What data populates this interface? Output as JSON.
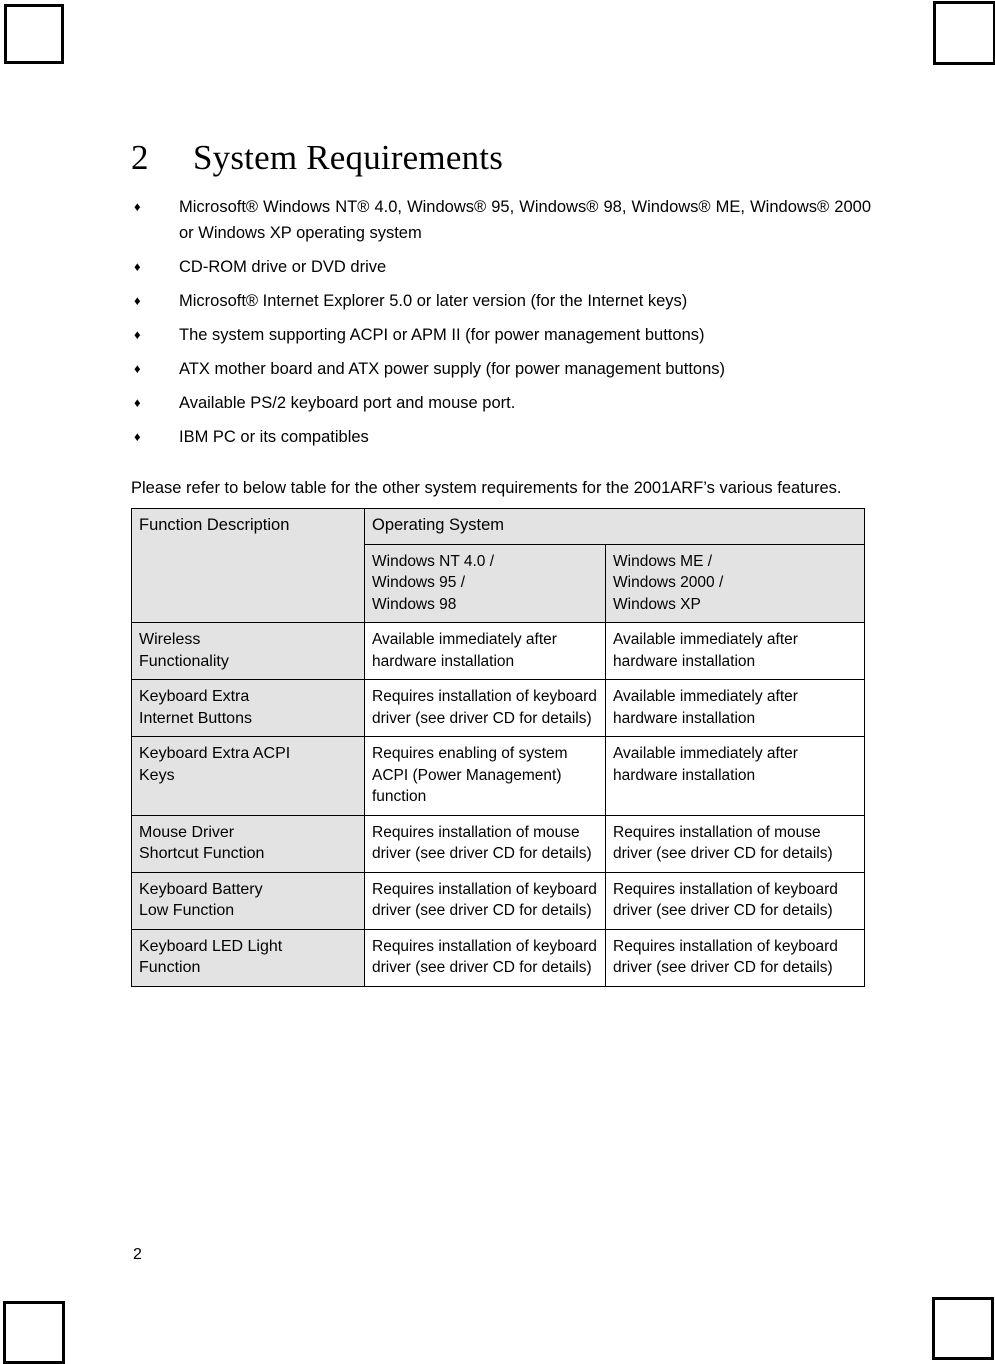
{
  "document": {
    "chapter_number": "2",
    "chapter_title": "System Requirements",
    "page_number": "2",
    "intro_paragraph": "Please refer to below table for the other system requirements for the 2001ARF’s various features.",
    "bullet_glyph": "♦",
    "requirements": [
      "Microsoft® Windows NT® 4.0, Windows® 95, Windows® 98, Windows® ME, Windows® 2000 or Windows XP operating system",
      "CD-ROM drive or DVD drive",
      "Microsoft® Internet Explorer 5.0 or later version (for the Internet keys)",
      "The system supporting ACPI or APM II (for power management buttons)",
      "ATX mother board and ATX power supply (for power management buttons)",
      "Available PS/2 keyboard port and mouse port.",
      "IBM PC or its compatibles"
    ]
  },
  "table": {
    "header": {
      "function_column": "Function Description",
      "group_title": "Operating System",
      "os_column_1": {
        "line1": "Windows NT 4.0 /",
        "line2": "Windows 95 /",
        "line3": "Windows 98"
      },
      "os_column_2": {
        "line1": "Windows ME /",
        "line2": "Windows 2000 /",
        "line3": "Windows XP"
      }
    },
    "rows": [
      {
        "function_line1": "Wireless",
        "function_line2": "Functionality",
        "os1": "Available immediately after hardware installation",
        "os2": "Available immediately after hardware installation"
      },
      {
        "function_line1": "Keyboard Extra",
        "function_line2": "Internet Buttons",
        "os1": "Requires installation of keyboard driver (see driver CD for details)",
        "os2": "Available immediately after hardware installation"
      },
      {
        "function_line1": "Keyboard Extra ACPI",
        "function_line2": "Keys",
        "os1": "Requires enabling of system ACPI (Power Management) function",
        "os2": "Available immediately after hardware installation"
      },
      {
        "function_line1": "Mouse Driver",
        "function_line2": "Shortcut Function",
        "os1": "Requires installation of mouse driver (see driver CD for details)",
        "os2": "Requires installation of mouse driver (see driver CD for details)"
      },
      {
        "function_line1": "Keyboard Battery",
        "function_line2": "Low Function",
        "os1": "Requires installation of keyboard driver (see driver CD for details)",
        "os2": "Requires installation of keyboard driver (see driver CD for details)"
      },
      {
        "function_line1": "Keyboard LED Light",
        "function_line2": "Function",
        "os1": "Requires installation of keyboard driver (see driver CD for details)",
        "os2": "Requires installation of keyboard driver (see driver CD for details)"
      }
    ]
  },
  "colors": {
    "shading": "#e3e3e3",
    "border": "#000000",
    "text": "#000000",
    "background": "#ffffff"
  }
}
